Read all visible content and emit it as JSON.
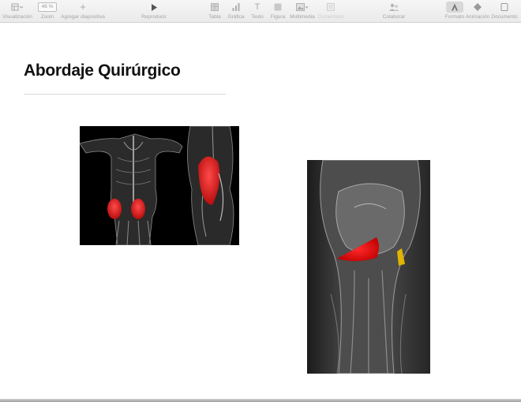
{
  "toolbar": {
    "view_label": "Visualización",
    "zoom_value": "46 %",
    "zoom_label": "Zoom",
    "add_slide_label": "Agregar diapositiva",
    "play_label": "Reproducir",
    "table_label": "Tabla",
    "chart_label": "Gráfica",
    "text_label": "Texto",
    "shape_label": "Figura",
    "media_label": "Multimedia",
    "comment_label": "Comentario",
    "collaborate_label": "Colaborar",
    "format_label": "Formato",
    "animate_label": "Animación",
    "document_label": "Documento"
  },
  "slide": {
    "title": "Abordaje Quirúrgico"
  }
}
